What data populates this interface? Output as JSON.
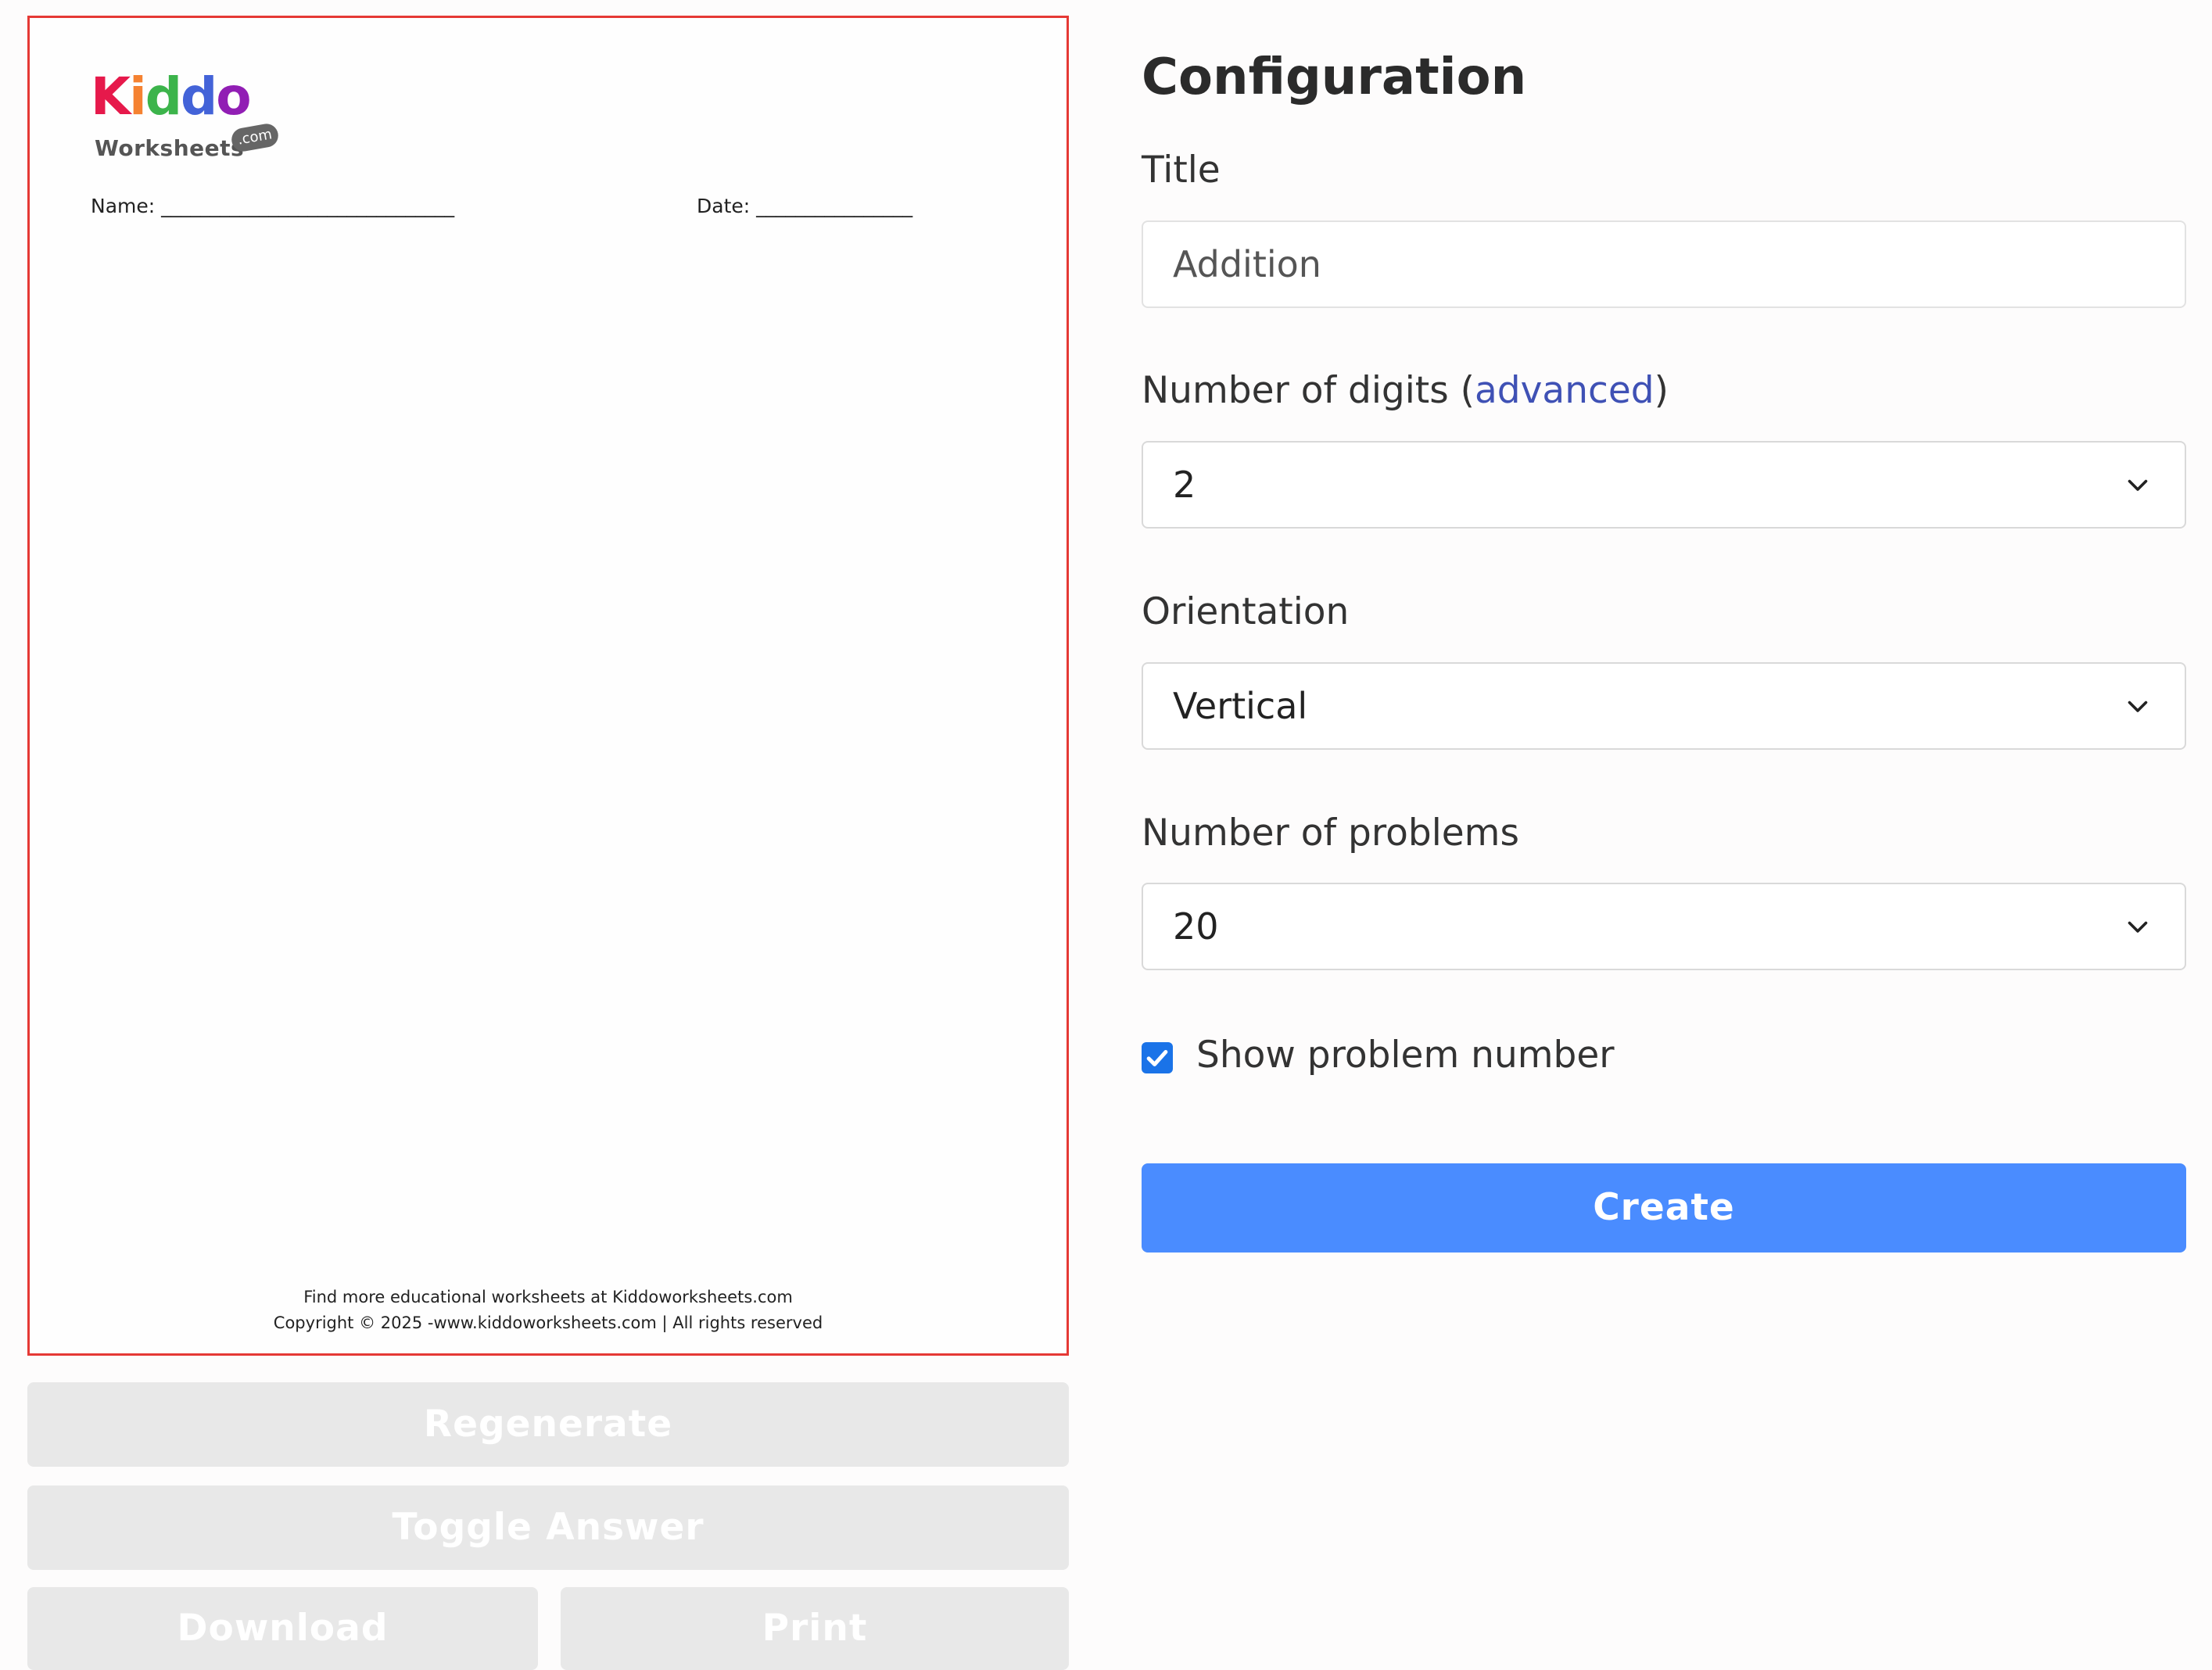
{
  "worksheet": {
    "logo": {
      "word": "Kiddo",
      "sub": "Worksheets",
      "com": ".com"
    },
    "name_label": "Name: ______________________________",
    "date_label": "Date: ________________",
    "footer_line1": "Find more educational worksheets at Kiddoworksheets.com",
    "footer_line2": "Copyright © 2025 -www.kiddoworksheets.com | All rights reserved",
    "border_color": "#e53935"
  },
  "actions": {
    "regenerate": "Regenerate",
    "toggle_answer": "Toggle Answer",
    "download": "Download",
    "print": "Print"
  },
  "config": {
    "heading": "Configuration",
    "title_label": "Title",
    "title_value": "Addition",
    "digits_label": "Number of digits (",
    "digits_link": "advanced",
    "digits_label_end": ")",
    "digits_value": "2",
    "orientation_label": "Orientation",
    "orientation_value": "Vertical",
    "problems_label": "Number of problems",
    "problems_value": "20",
    "show_number_label": "Show problem number",
    "show_number_checked": true,
    "create_label": "Create"
  },
  "colors": {
    "accent": "#4a8cff",
    "link": "#3f51b5",
    "checkbox": "#1a73e8",
    "disabled": "#e8e8e8"
  }
}
